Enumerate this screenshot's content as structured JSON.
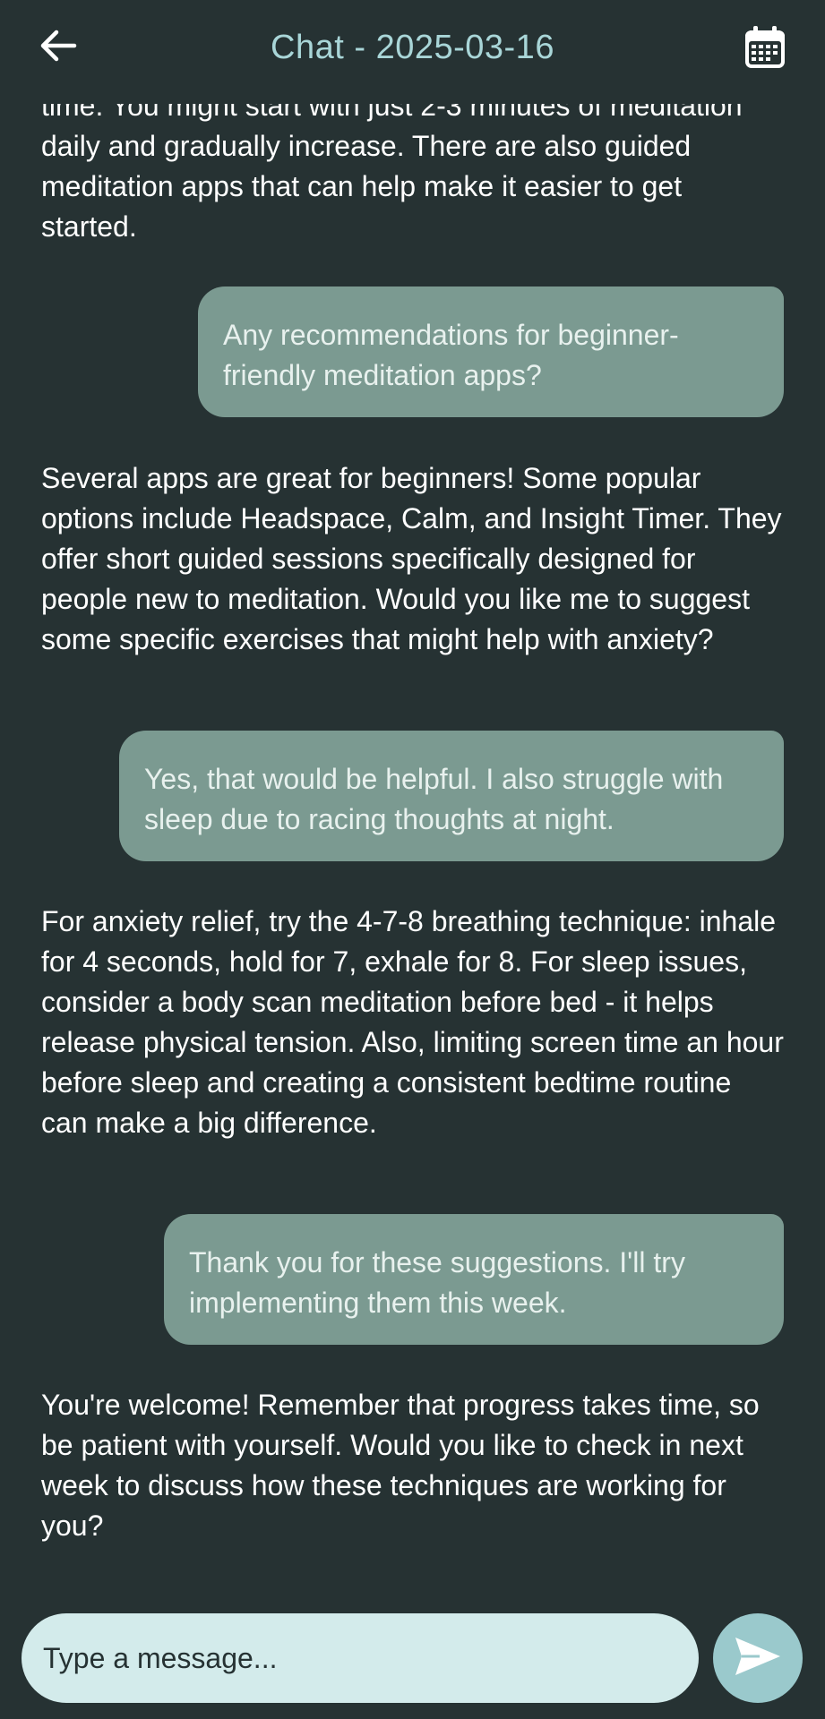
{
  "header": {
    "title": "Chat - 2025-03-16",
    "back_icon": "arrow-left-icon",
    "calendar_icon": "calendar-icon"
  },
  "messages": [
    {
      "role": "assistant",
      "text": "time. You might start with just 2-3 minutes of meditation daily and gradually increase. There are also guided meditation apps that can help make it easier to get started."
    },
    {
      "role": "user",
      "text": "Any recommendations for beginner-friendly meditation apps?"
    },
    {
      "role": "assistant",
      "text": "Several apps are great for beginners! Some popular options include Headspace, Calm, and Insight Timer. They offer short guided sessions specifically designed for people new to meditation. Would you like me to suggest some specific exercises that might help with anxiety?"
    },
    {
      "role": "user",
      "text": "Yes, that would be helpful. I also struggle with sleep due to racing thoughts at night."
    },
    {
      "role": "assistant",
      "text": "For anxiety relief, try the 4-7-8 breathing technique: inhale for 4 seconds, hold for 7, exhale for 8. For sleep issues, consider a body scan meditation before bed - it helps release physical tension. Also, limiting screen time an hour before sleep and creating a consistent bedtime routine can make a big difference."
    },
    {
      "role": "user",
      "text": "Thank you for these suggestions. I'll try implementing them this week."
    },
    {
      "role": "assistant",
      "text": "You're welcome! Remember that progress takes time, so be patient with yourself. Would you like to check in next week to discuss how these techniques are working for you?"
    }
  ],
  "composer": {
    "placeholder": "Type a message...",
    "value": "",
    "send_icon": "send-icon"
  },
  "colors": {
    "background": "#263233",
    "title": "#a9d6d8",
    "user_bubble": "#7b9a91",
    "input_bg": "#d3ebeb",
    "send_button": "#9ac9cc"
  }
}
